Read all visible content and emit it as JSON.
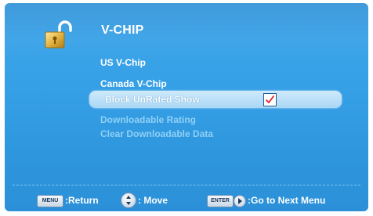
{
  "header": {
    "title": "V-CHIP",
    "icon": "unlocked-padlock-icon"
  },
  "menu": {
    "items": [
      {
        "label": "US V-Chip",
        "state": "enabled"
      },
      {
        "label": "Canada V-Chip",
        "state": "enabled"
      },
      {
        "label": "Block UnRated Show",
        "state": "selected",
        "checked": true
      },
      {
        "label": "Downloadable Rating",
        "state": "disabled"
      },
      {
        "label": "Clear Downloadable Data",
        "state": "disabled"
      }
    ]
  },
  "footer": {
    "menu_key": "MENU",
    "return_label": ":Return",
    "move_label": ": Move",
    "enter_key": "ENTER",
    "next_label": ":Go to Next Menu"
  },
  "colors": {
    "background": "#36a0e6",
    "highlight": "#bfe3f9",
    "check": "#e0242e",
    "disabled_text": "#8fd0f6"
  }
}
